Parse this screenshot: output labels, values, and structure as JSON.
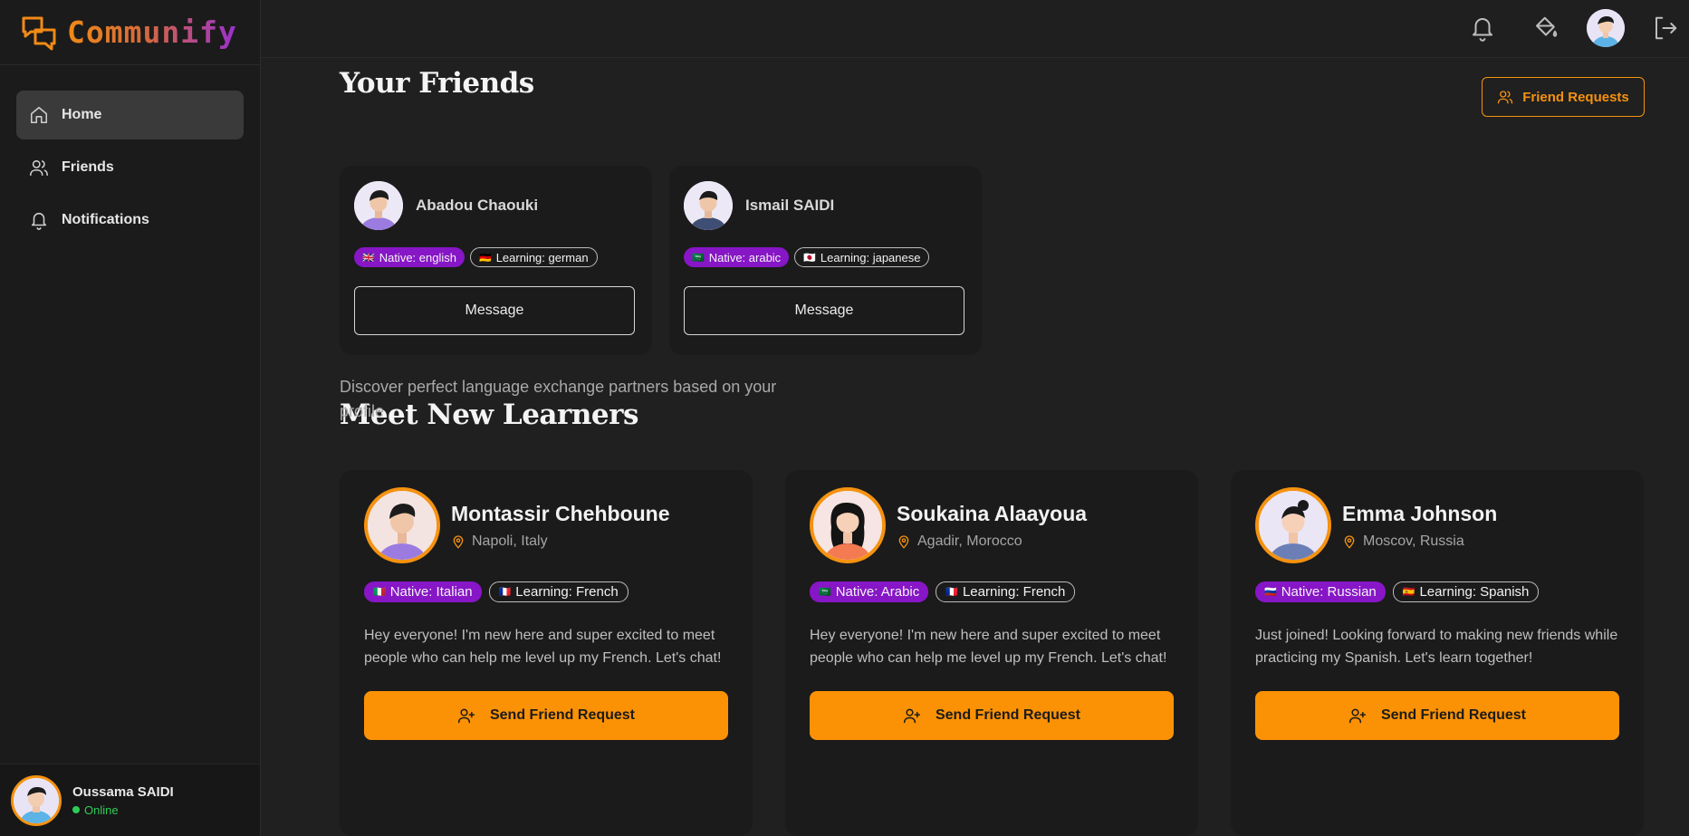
{
  "app": {
    "name": "Communify"
  },
  "sidebar": {
    "items": [
      {
        "label": "Home",
        "icon": "home-icon",
        "active": true
      },
      {
        "label": "Friends",
        "icon": "users-icon",
        "active": false
      },
      {
        "label": "Notifications",
        "icon": "bell-icon",
        "active": false
      }
    ],
    "user": {
      "name": "Oussama SAIDI",
      "status": "Online"
    }
  },
  "header": {
    "icons": [
      "bell-icon",
      "paint-bucket-icon",
      "avatar",
      "logout-icon"
    ]
  },
  "friends_section": {
    "title": "Your Friends",
    "requests_button": "Friend Requests",
    "friends": [
      {
        "name": "Abadou Chaouki",
        "native": "🇬🇧",
        "native_label": "Native: english",
        "learning": "🇩🇪",
        "learning_label": "Learning: german",
        "button": "Message"
      },
      {
        "name": "Ismail SAIDI",
        "native": "🇸🇦",
        "native_label": "Native: arabic",
        "learning": "🇯🇵",
        "learning_label": "Learning: japanese",
        "button": "Message"
      }
    ]
  },
  "learners_section": {
    "title": "Meet New Learners",
    "subtitle": "Discover perfect language exchange partners based on your profile",
    "learners": [
      {
        "name": "Montassir Chehboune",
        "location": "Napoli, Italy",
        "native": "🇮🇹",
        "native_label": "Native: Italian",
        "learning": "🇫🇷",
        "learning_label": "Learning: French",
        "bio": "Hey everyone! I'm new here and super excited to meet people who can help me level up my French. Let's chat!",
        "button": "Send Friend Request"
      },
      {
        "name": "Soukaina Alaayoua",
        "location": "Agadir, Morocco",
        "native": "🇸🇦",
        "native_label": "Native: Arabic",
        "learning": "🇫🇷",
        "learning_label": "Learning: French",
        "bio": "Hey everyone! I'm new here and super excited to meet people who can help me level up my French. Let's chat!",
        "button": "Send Friend Request"
      },
      {
        "name": "Emma Johnson",
        "location": "Moscov, Russia",
        "native": "🇷🇺",
        "native_label": "Native: Russian",
        "learning": "🇪🇸",
        "learning_label": "Learning: Spanish",
        "bio": "Just joined! Looking forward to making new friends while practicing my Spanish. Let's learn together!",
        "button": "Send Friend Request"
      }
    ]
  },
  "colors": {
    "accent": "#fb9205",
    "native_tag": "#8716c6",
    "online": "#2ecc57"
  }
}
